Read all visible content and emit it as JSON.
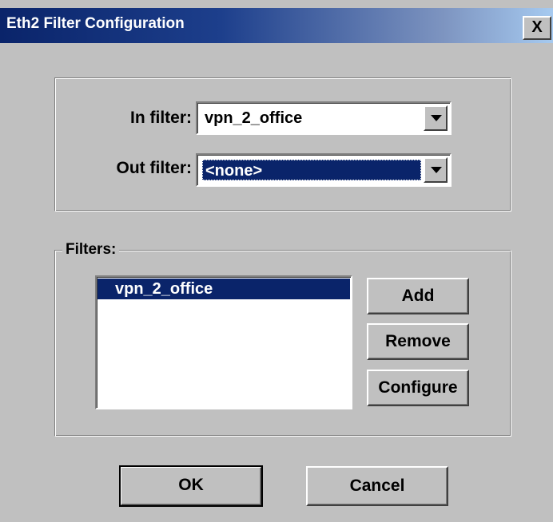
{
  "window": {
    "title": "Eth2 Filter Configuration",
    "close_label": "X"
  },
  "in_filter": {
    "label": "In filter:",
    "value": "vpn_2_office"
  },
  "out_filter": {
    "label": "Out filter:",
    "value": "<none>"
  },
  "filters": {
    "legend": "Filters:",
    "items": [
      {
        "label": "vpn_2_office",
        "selected": true
      }
    ]
  },
  "buttons": {
    "add": "Add",
    "remove": "Remove",
    "configure": "Configure",
    "ok": "OK",
    "cancel": "Cancel"
  },
  "colors": {
    "face": "#c0c0c0",
    "selection": "#0a246a",
    "titlebar_start": "#0a246a",
    "titlebar_end": "#a6caf0"
  }
}
